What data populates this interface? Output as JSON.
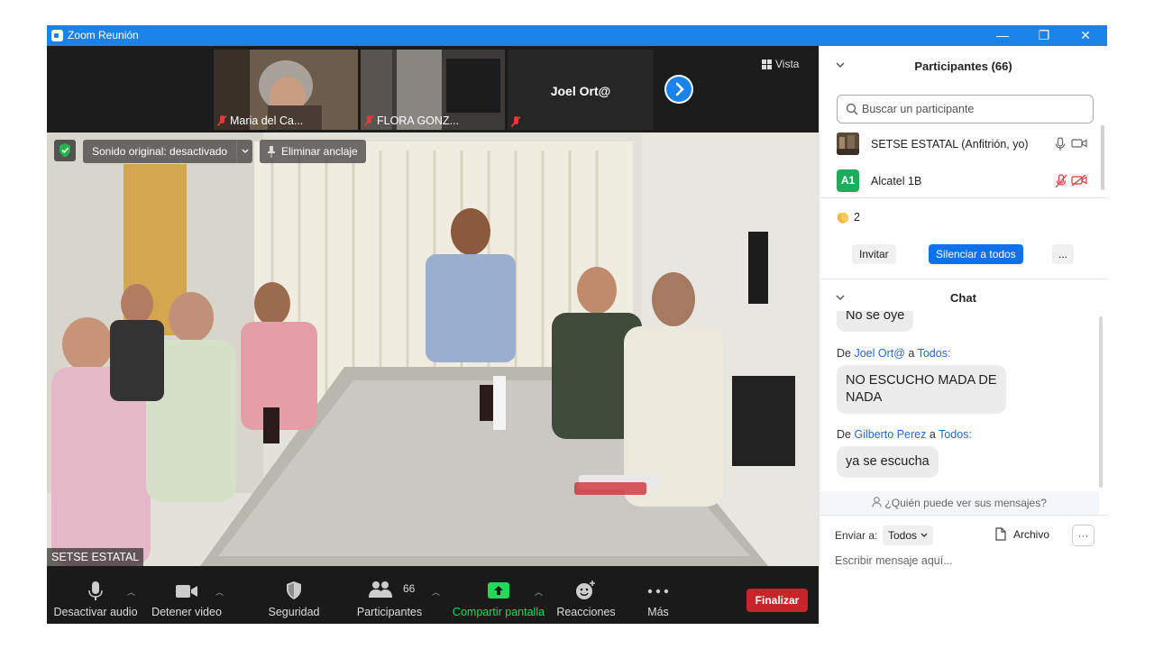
{
  "window": {
    "title": "Zoom Reunión",
    "minimize": "—",
    "restore": "❐",
    "close": "✕"
  },
  "top_strip": {
    "thumbnails": [
      {
        "name": "Maria del Ca..."
      },
      {
        "name": "FLORA GONZ..."
      },
      {
        "name": ""
      }
    ],
    "speaker_name": "Joel Ort@",
    "view_label": "Vista"
  },
  "main_video": {
    "sound_label": "Sonido original: desactivado",
    "unpin_label": "Eliminar anclaje",
    "name_label": "SETSE ESTATAL"
  },
  "toolbar": {
    "mute_label": "Desactivar audio",
    "video_label": "Detener video",
    "security_label": "Seguridad",
    "participants_label": "Participantes",
    "participants_count": "66",
    "share_label": "Compartir pantalla",
    "reactions_label": "Reacciones",
    "more_label": "Más",
    "end_label": "Finalizar"
  },
  "participants_panel": {
    "title": "Participantes (66)",
    "search_placeholder": "Buscar un participante",
    "participants": [
      {
        "name": "SETSE ESTATAL (Anfitrión, yo)"
      },
      {
        "initials": "A1",
        "name": "Alcatel 1B"
      }
    ],
    "reaction_count": "2",
    "invite_label": "Invitar",
    "mute_all_label": "Silenciar a todos",
    "more_label": "..."
  },
  "chat_panel": {
    "title": "Chat",
    "partial_message": "No se oye",
    "messages": [
      {
        "prefix": "De",
        "sender": "Joel Ort@",
        "mid": "a",
        "to": "Todos:",
        "text_line1": "NO ESCUCHO MADA DE",
        "text_line2": "NADA"
      },
      {
        "prefix": "De",
        "sender": "Gilberto Perez",
        "mid": "a",
        "to": "Todos:",
        "text": "ya se escucha"
      }
    ],
    "visibility_note": "¿Quién puede ver sus mensajes?",
    "send_to_label": "Enviar a:",
    "send_to_value": "Todos",
    "file_label": "Archivo",
    "more_label": "···",
    "input_placeholder": "Escribir mensaje aquí..."
  },
  "colors": {
    "title_bar": "#1a82e8",
    "share_green": "#23d959",
    "end_red": "#c8252a",
    "mute_all_blue": "#0e72ed",
    "link_blue": "#2369c5"
  }
}
